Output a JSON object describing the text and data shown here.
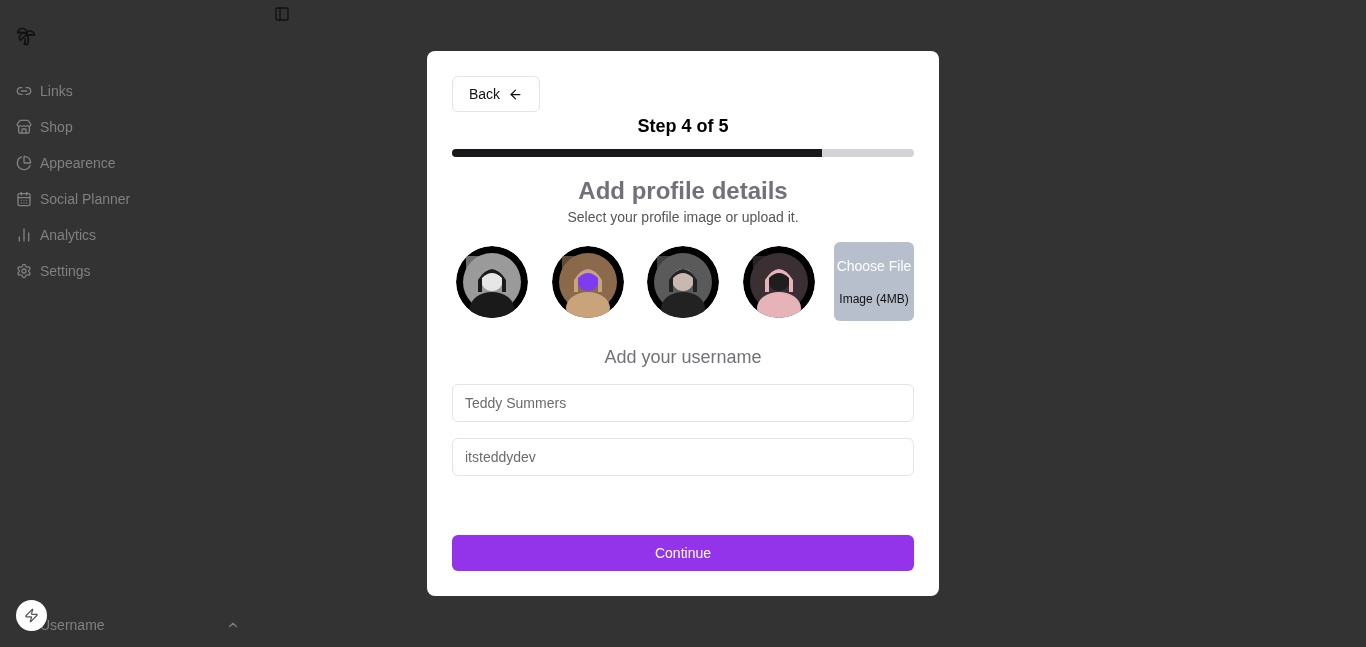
{
  "sidebar": {
    "items": [
      {
        "label": "Links"
      },
      {
        "label": "Shop"
      },
      {
        "label": "Appearence"
      },
      {
        "label": "Social Planner"
      },
      {
        "label": "Analytics"
      },
      {
        "label": "Settings"
      }
    ],
    "user": {
      "label": "Username"
    }
  },
  "dialog": {
    "back_button": "Back",
    "step": "Step 4 of 5",
    "progress": {
      "level": 0.8
    },
    "title": "Add profile details",
    "subtitle": "Select your profile image or upload it.",
    "upload": {
      "button": "Choose File",
      "hint": "Image (4MB)"
    },
    "username_heading": "Add your username",
    "fields": [
      {
        "placeholder": "Teddy Summers"
      },
      {
        "placeholder": "itsteddydev"
      }
    ],
    "continue_button": "Continue"
  }
}
